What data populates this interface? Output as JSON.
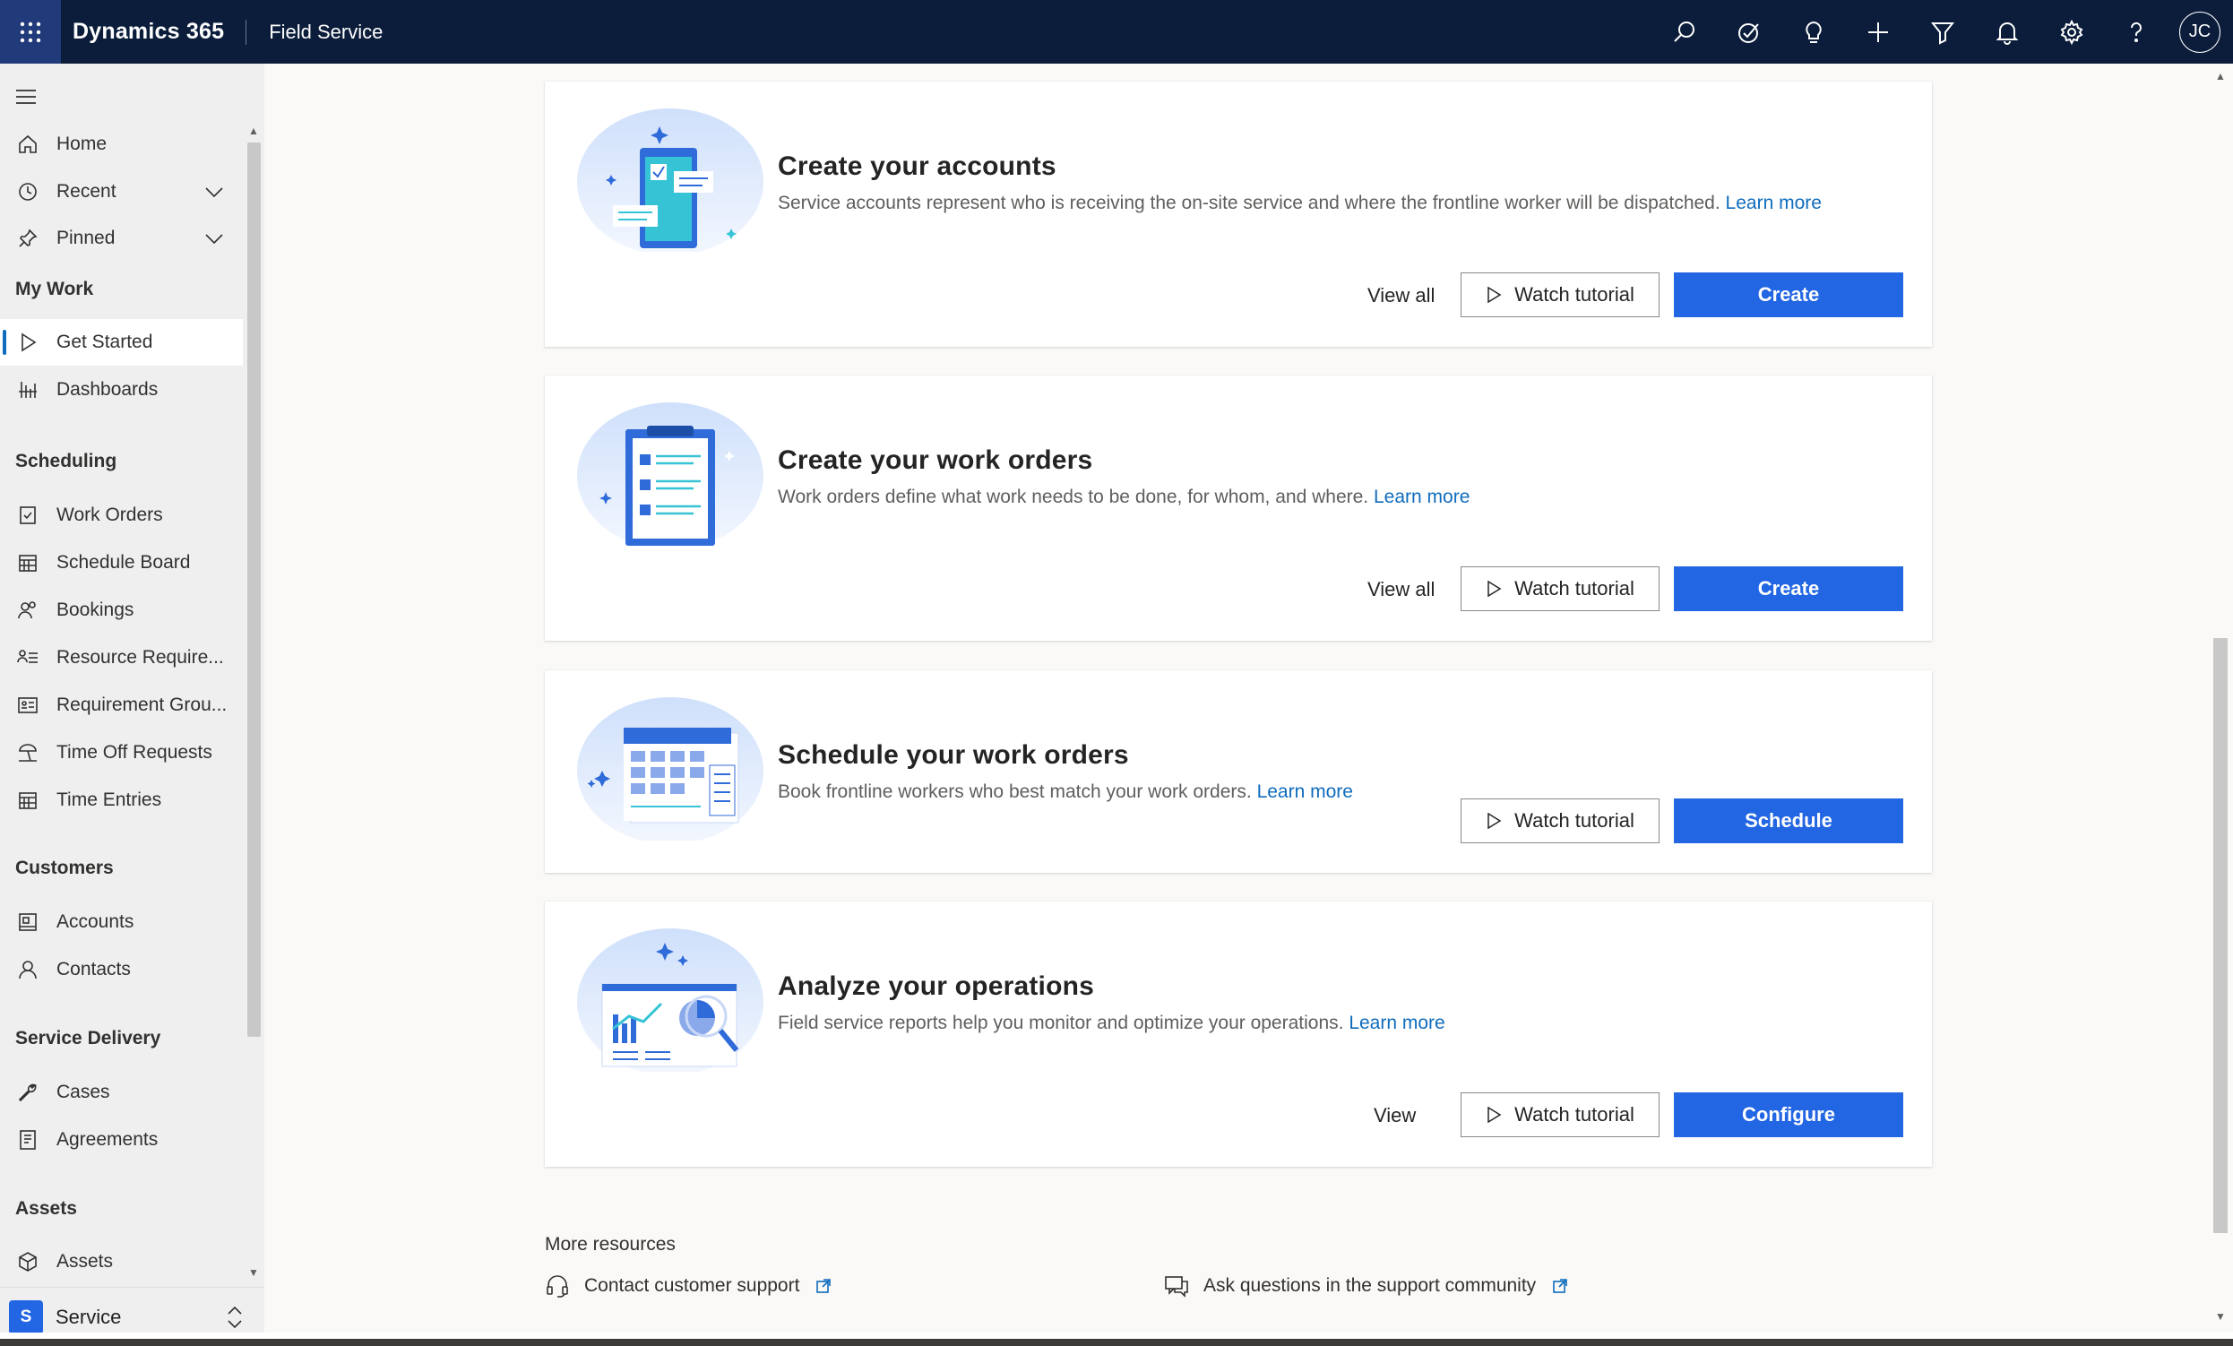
{
  "topbar": {
    "brand": "Dynamics 365",
    "app_name": "Field Service",
    "avatar_initials": "JC",
    "icons": [
      "search-icon",
      "task-icon",
      "lightbulb-icon",
      "plus-icon",
      "filter-icon",
      "bell-icon",
      "gear-icon",
      "help-icon"
    ]
  },
  "sidebar": {
    "top_items": [
      {
        "label": "Home",
        "icon": "home-icon"
      },
      {
        "label": "Recent",
        "icon": "clock-icon"
      },
      {
        "label": "Pinned",
        "icon": "pin-icon"
      }
    ],
    "groups": {
      "my_work": {
        "title": "My Work",
        "items": [
          {
            "label": "Get Started",
            "icon": "play-icon"
          },
          {
            "label": "Dashboards",
            "icon": "dashboard-icon"
          }
        ]
      },
      "scheduling": {
        "title": "Scheduling",
        "items": [
          {
            "label": "Work Orders",
            "icon": "work-order-icon"
          },
          {
            "label": "Schedule Board",
            "icon": "calendar-icon"
          },
          {
            "label": "Bookings",
            "icon": "people-icon"
          },
          {
            "label": "Resource Require...",
            "icon": "list-person-icon"
          },
          {
            "label": "Requirement Grou...",
            "icon": "group-card-icon"
          },
          {
            "label": "Time Off Requests",
            "icon": "beach-icon"
          },
          {
            "label": "Time Entries",
            "icon": "calendar-icon"
          }
        ]
      },
      "customers": {
        "title": "Customers",
        "items": [
          {
            "label": "Accounts",
            "icon": "building-icon"
          },
          {
            "label": "Contacts",
            "icon": "person-icon"
          }
        ]
      },
      "service_delivery": {
        "title": "Service Delivery",
        "items": [
          {
            "label": "Cases",
            "icon": "wrench-icon"
          },
          {
            "label": "Agreements",
            "icon": "document-icon"
          }
        ]
      },
      "assets": {
        "title": "Assets",
        "items": [
          {
            "label": "Assets",
            "icon": "cube-icon"
          }
        ]
      }
    },
    "area": {
      "badge": "S",
      "label": "Service"
    }
  },
  "cards": [
    {
      "title": "Create your accounts",
      "description": "Service accounts represent who is receiving the on-site service and where the frontline worker will be dispatched.",
      "learn_more": "Learn more",
      "link_label": "View all",
      "tutorial_label": "Watch tutorial",
      "primary_label": "Create"
    },
    {
      "title": "Create your work orders",
      "description": "Work orders define what work needs to be done, for whom, and where.",
      "learn_more": "Learn more",
      "link_label": "View all",
      "tutorial_label": "Watch tutorial",
      "primary_label": "Create"
    },
    {
      "title": "Schedule your work orders",
      "description": "Book frontline workers who best match your work orders.",
      "learn_more": "Learn more",
      "tutorial_label": "Watch tutorial",
      "primary_label": "Schedule"
    },
    {
      "title": "Analyze your operations",
      "description": "Field service reports help you monitor and optimize your operations.",
      "learn_more": "Learn more",
      "link_label": "View",
      "tutorial_label": "Watch tutorial",
      "primary_label": "Configure"
    }
  ],
  "more_resources": {
    "title": "More resources",
    "links": [
      {
        "label": "Contact customer support",
        "icon": "headset-icon"
      },
      {
        "label": "Ask questions in the support community",
        "icon": "chat-icon"
      }
    ]
  },
  "colors": {
    "topbar": "#0b1d3a",
    "waffle": "#213a79",
    "primary": "#2266e3",
    "link": "#0f6cbd",
    "sidebar": "#efefef"
  }
}
